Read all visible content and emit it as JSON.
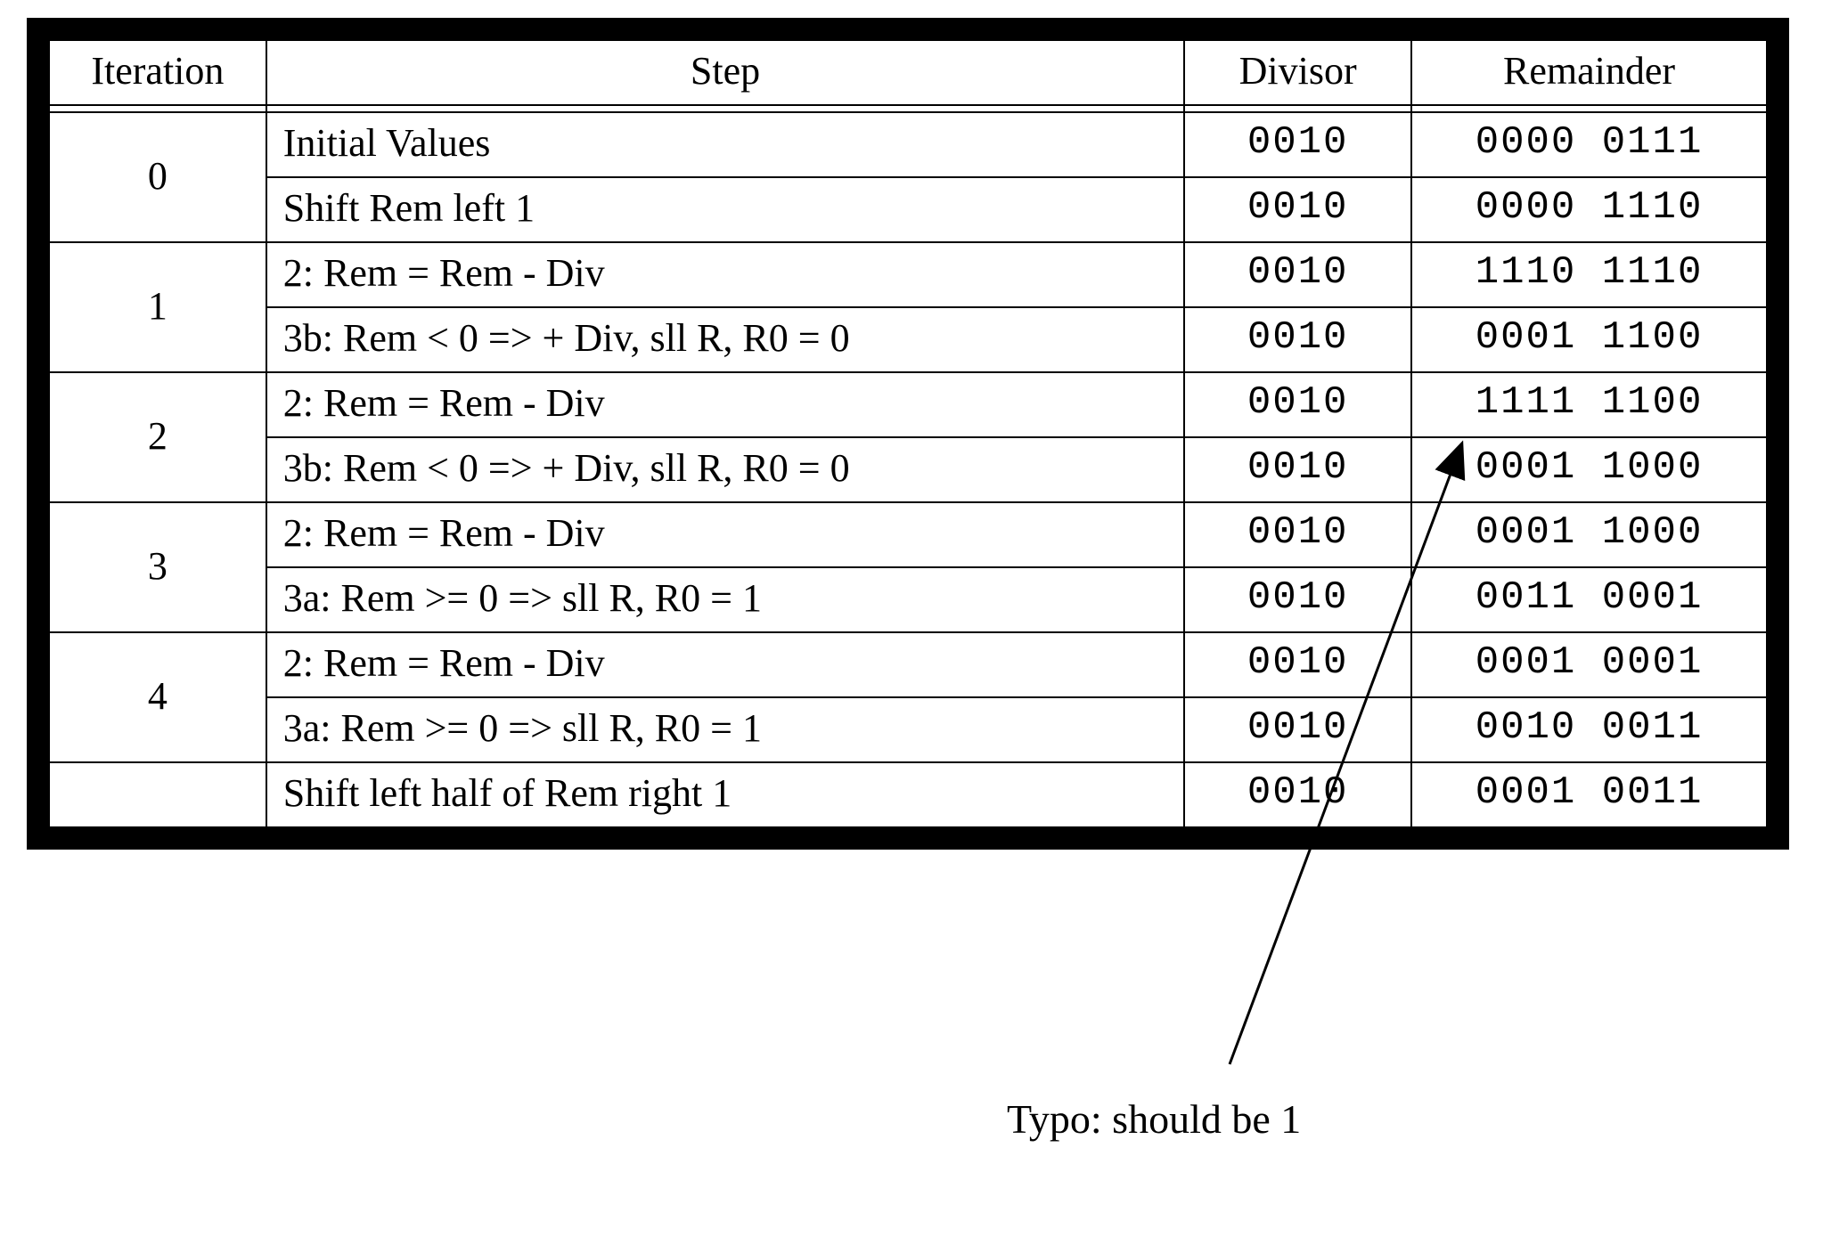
{
  "headers": {
    "iteration": "Iteration",
    "step": "Step",
    "divisor": "Divisor",
    "remainder": "Remainder"
  },
  "rows": [
    {
      "iter": "0",
      "rowspan": 2,
      "step": "Initial Values",
      "divisor": "0010",
      "remainder": "0000 0111"
    },
    {
      "step": "Shift Rem left 1",
      "divisor": "0010",
      "remainder": "0000 1110"
    },
    {
      "iter": "1",
      "rowspan": 2,
      "step": "2: Rem = Rem - Div",
      "divisor": "0010",
      "remainder": "1110 1110"
    },
    {
      "step": "3b: Rem < 0 => + Div, sll R, R0 = 0",
      "divisor": "0010",
      "remainder": "0001 1100"
    },
    {
      "iter": "2",
      "rowspan": 2,
      "step": "2: Rem = Rem - Div",
      "divisor": "0010",
      "remainder": "1111 1100"
    },
    {
      "step": "3b: Rem < 0 => + Div, sll R, R0 = 0",
      "divisor": "0010",
      "remainder": "0001 1000"
    },
    {
      "iter": "3",
      "rowspan": 2,
      "step": "2: Rem = Rem - Div",
      "divisor": "0010",
      "remainder": "0001 1000"
    },
    {
      "step": "3a: Rem >= 0 => sll R, R0 = 1",
      "divisor": "0010",
      "remainder": "0011 0001"
    },
    {
      "iter": "4",
      "rowspan": 2,
      "step": "2: Rem = Rem - Div",
      "divisor": "0010",
      "remainder": "0001 0001"
    },
    {
      "step": "3a: Rem >= 0 => sll R, R0 = 1",
      "divisor": "0010",
      "remainder": "0010 0011"
    },
    {
      "iter": "",
      "rowspan": 1,
      "step": "Shift left half of Rem right 1",
      "divisor": "0010",
      "remainder": "0001 0011"
    }
  ],
  "annotation": {
    "text": "Typo: should be 1"
  }
}
